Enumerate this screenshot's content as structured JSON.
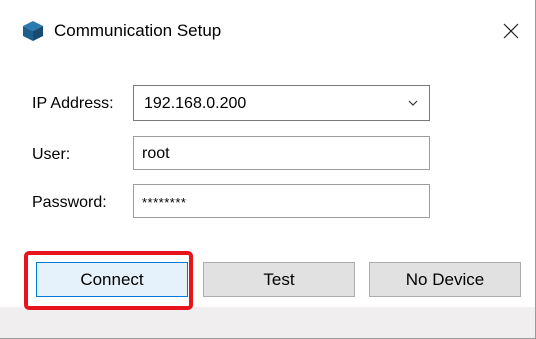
{
  "window": {
    "title": "Communication Setup",
    "icon": "cube-app-icon",
    "close_icon": "close-icon"
  },
  "form": {
    "ip_label": "IP Address:",
    "ip_value": "192.168.0.200",
    "user_label": "User:",
    "user_value": "root",
    "password_label": "Password:",
    "password_value": "********"
  },
  "buttons": {
    "connect": "Connect",
    "test": "Test",
    "no_device": "No Device"
  },
  "colors": {
    "highlight": "#e8141b",
    "focus_border": "#0078d7",
    "app_icon": "#1c5f8c"
  }
}
